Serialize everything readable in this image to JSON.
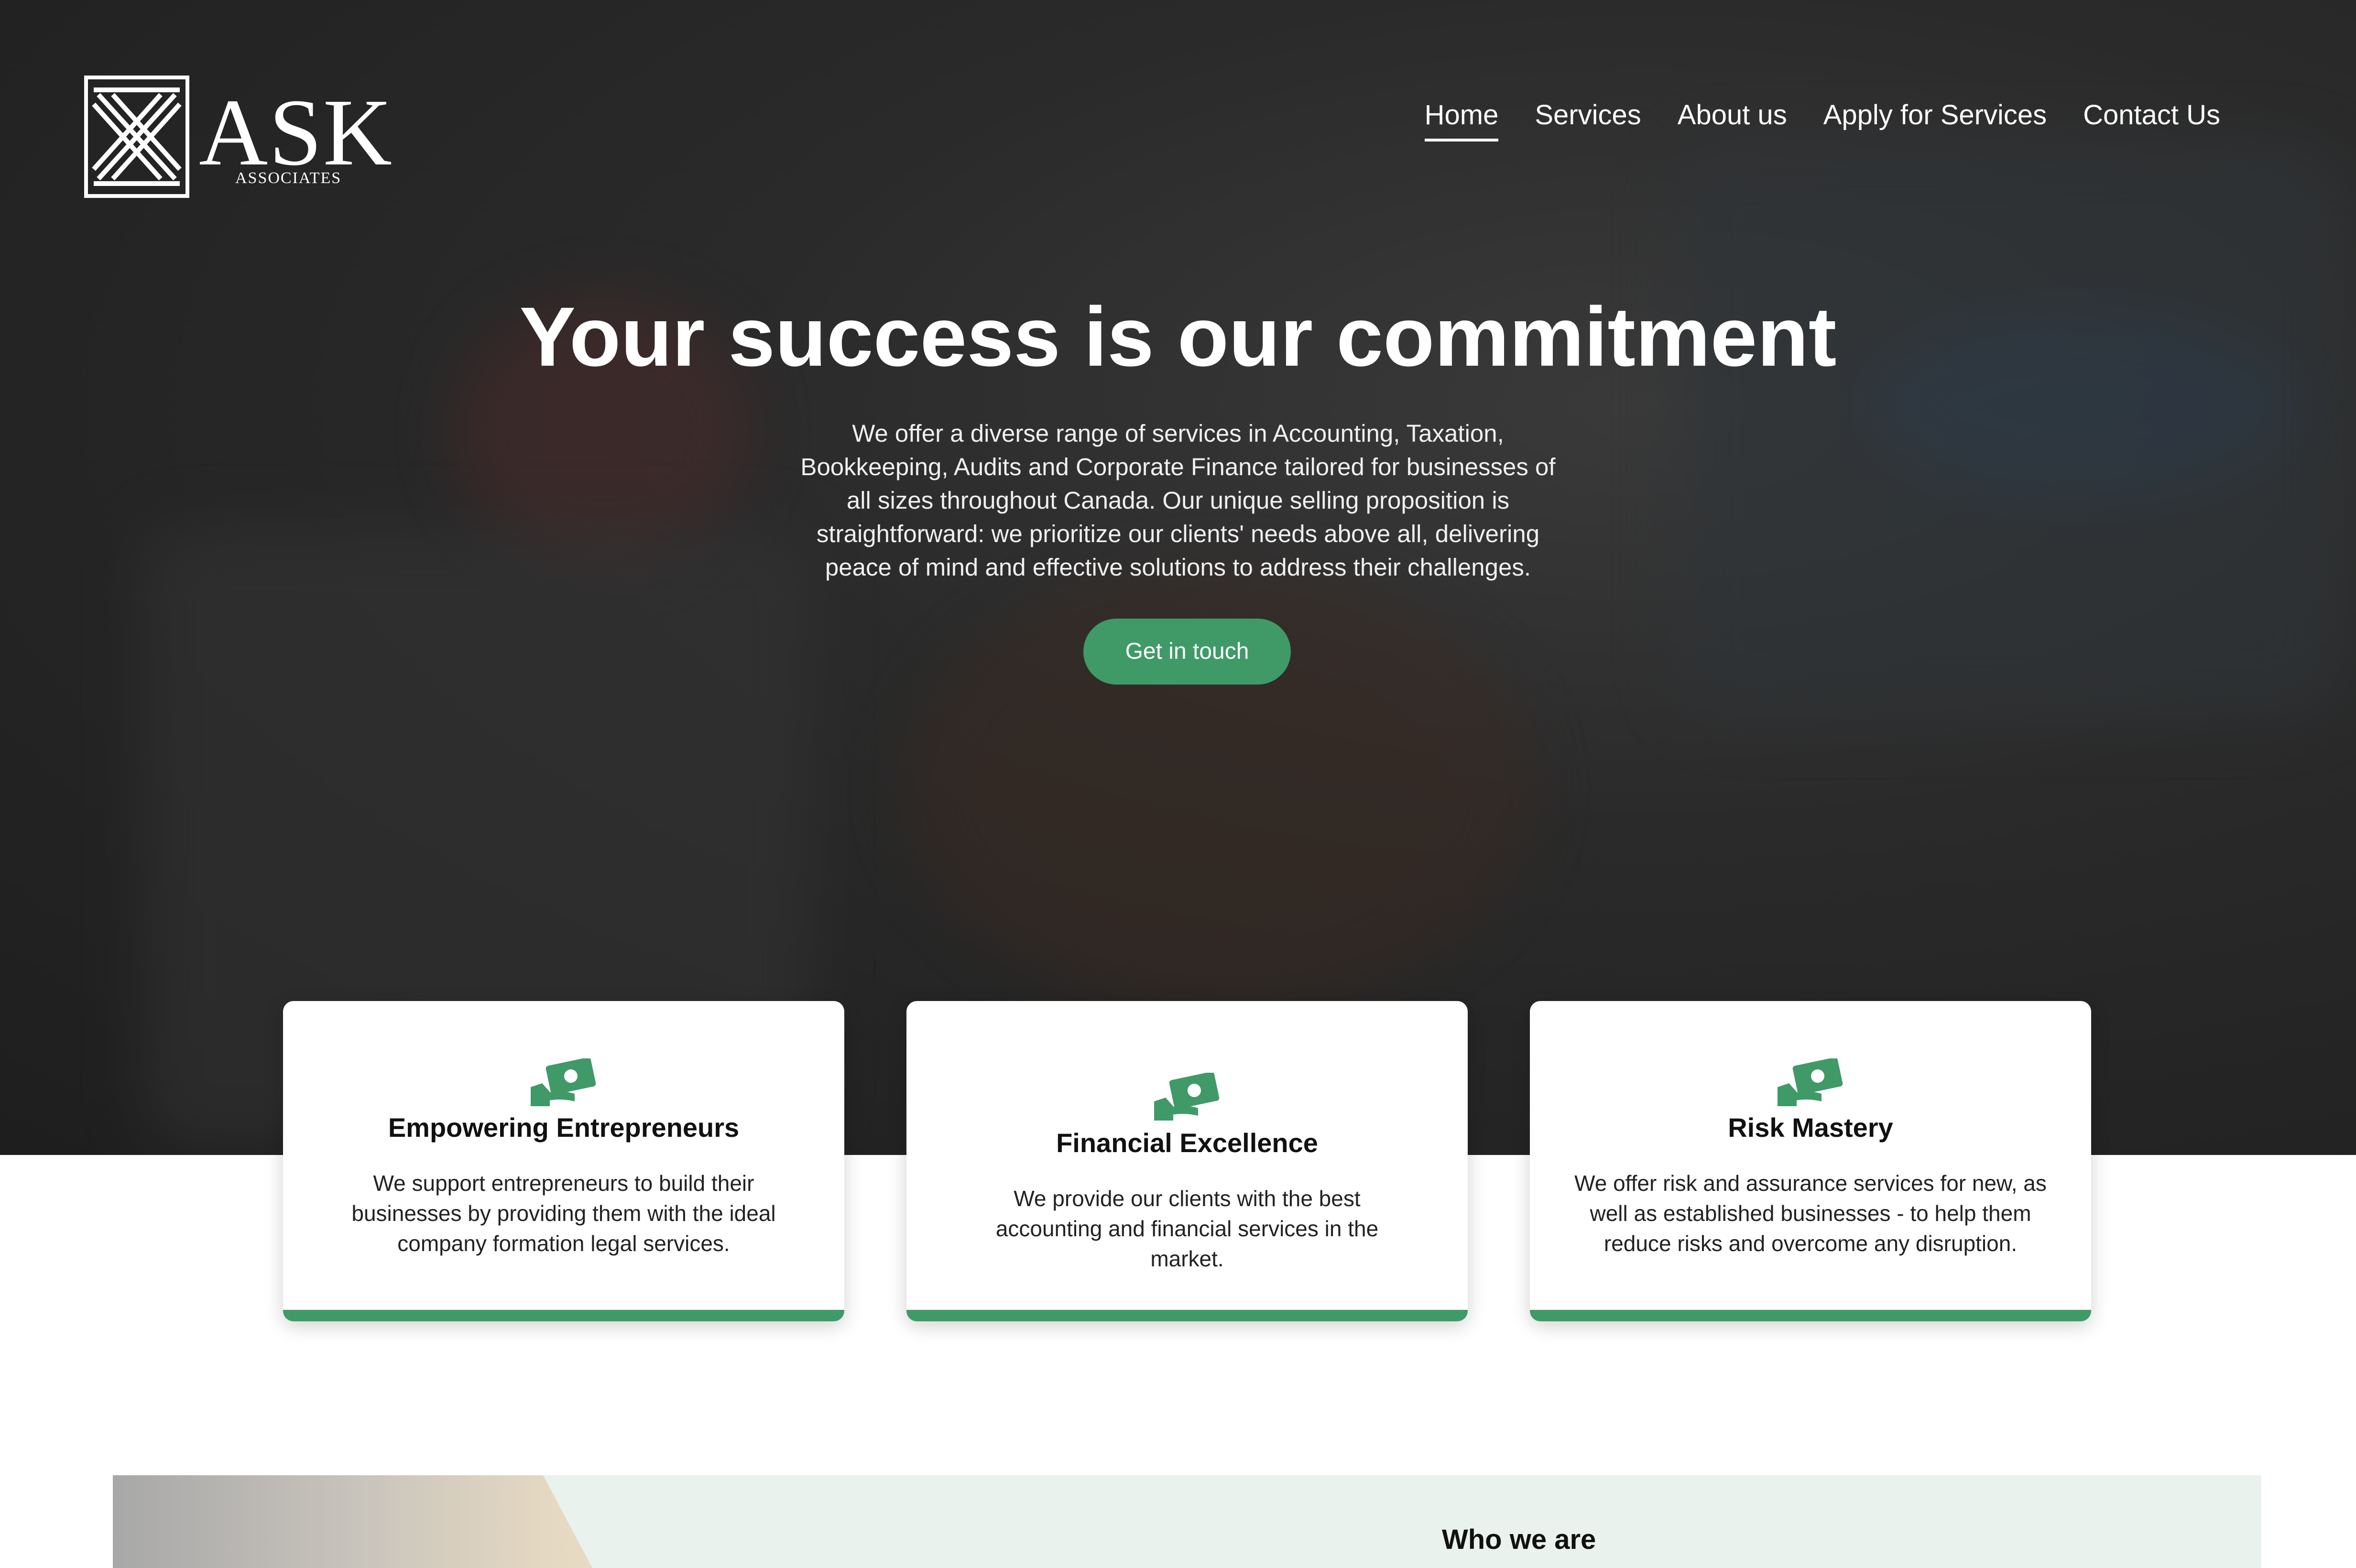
{
  "brand": {
    "name": "ASK",
    "subtitle": "ASSOCIATES",
    "logo_icon": "ask-x-logo"
  },
  "nav": {
    "items": [
      {
        "label": "Home",
        "active": true
      },
      {
        "label": "Services",
        "active": false
      },
      {
        "label": "About us",
        "active": false
      },
      {
        "label": "Apply for Services",
        "active": false
      },
      {
        "label": "Contact Us",
        "active": false
      }
    ]
  },
  "hero": {
    "title": "Your success is our commitment",
    "description": "We offer a diverse range of services in Accounting, Taxation, Bookkeeping, Audits and Corporate Finance tailored for businesses of all sizes throughout Canada. Our unique selling proposition is straightforward: we prioritize our clients' needs above all, delivering peace of mind and effective solutions to address their challenges.",
    "cta_label": "Get in touch"
  },
  "cards": [
    {
      "icon": "money-hand-icon",
      "title": "Empowering Entrepreneurs",
      "text": "We support entrepreneurs to build their businesses by providing them with the ideal company formation legal services."
    },
    {
      "icon": "money-hand-icon",
      "title": "Financial Excellence",
      "text": "We provide our clients with the best accounting and financial services in the market."
    },
    {
      "icon": "money-hand-icon",
      "title": "Risk Mastery",
      "text": "We offer risk and assurance services for new, as well as established businesses - to help them reduce risks and overcome any disruption."
    }
  ],
  "who": {
    "title": "Who we are"
  },
  "colors": {
    "accent": "#3f9a68",
    "hero_bg": "#262626",
    "who_bg": "#eaf2ee"
  }
}
